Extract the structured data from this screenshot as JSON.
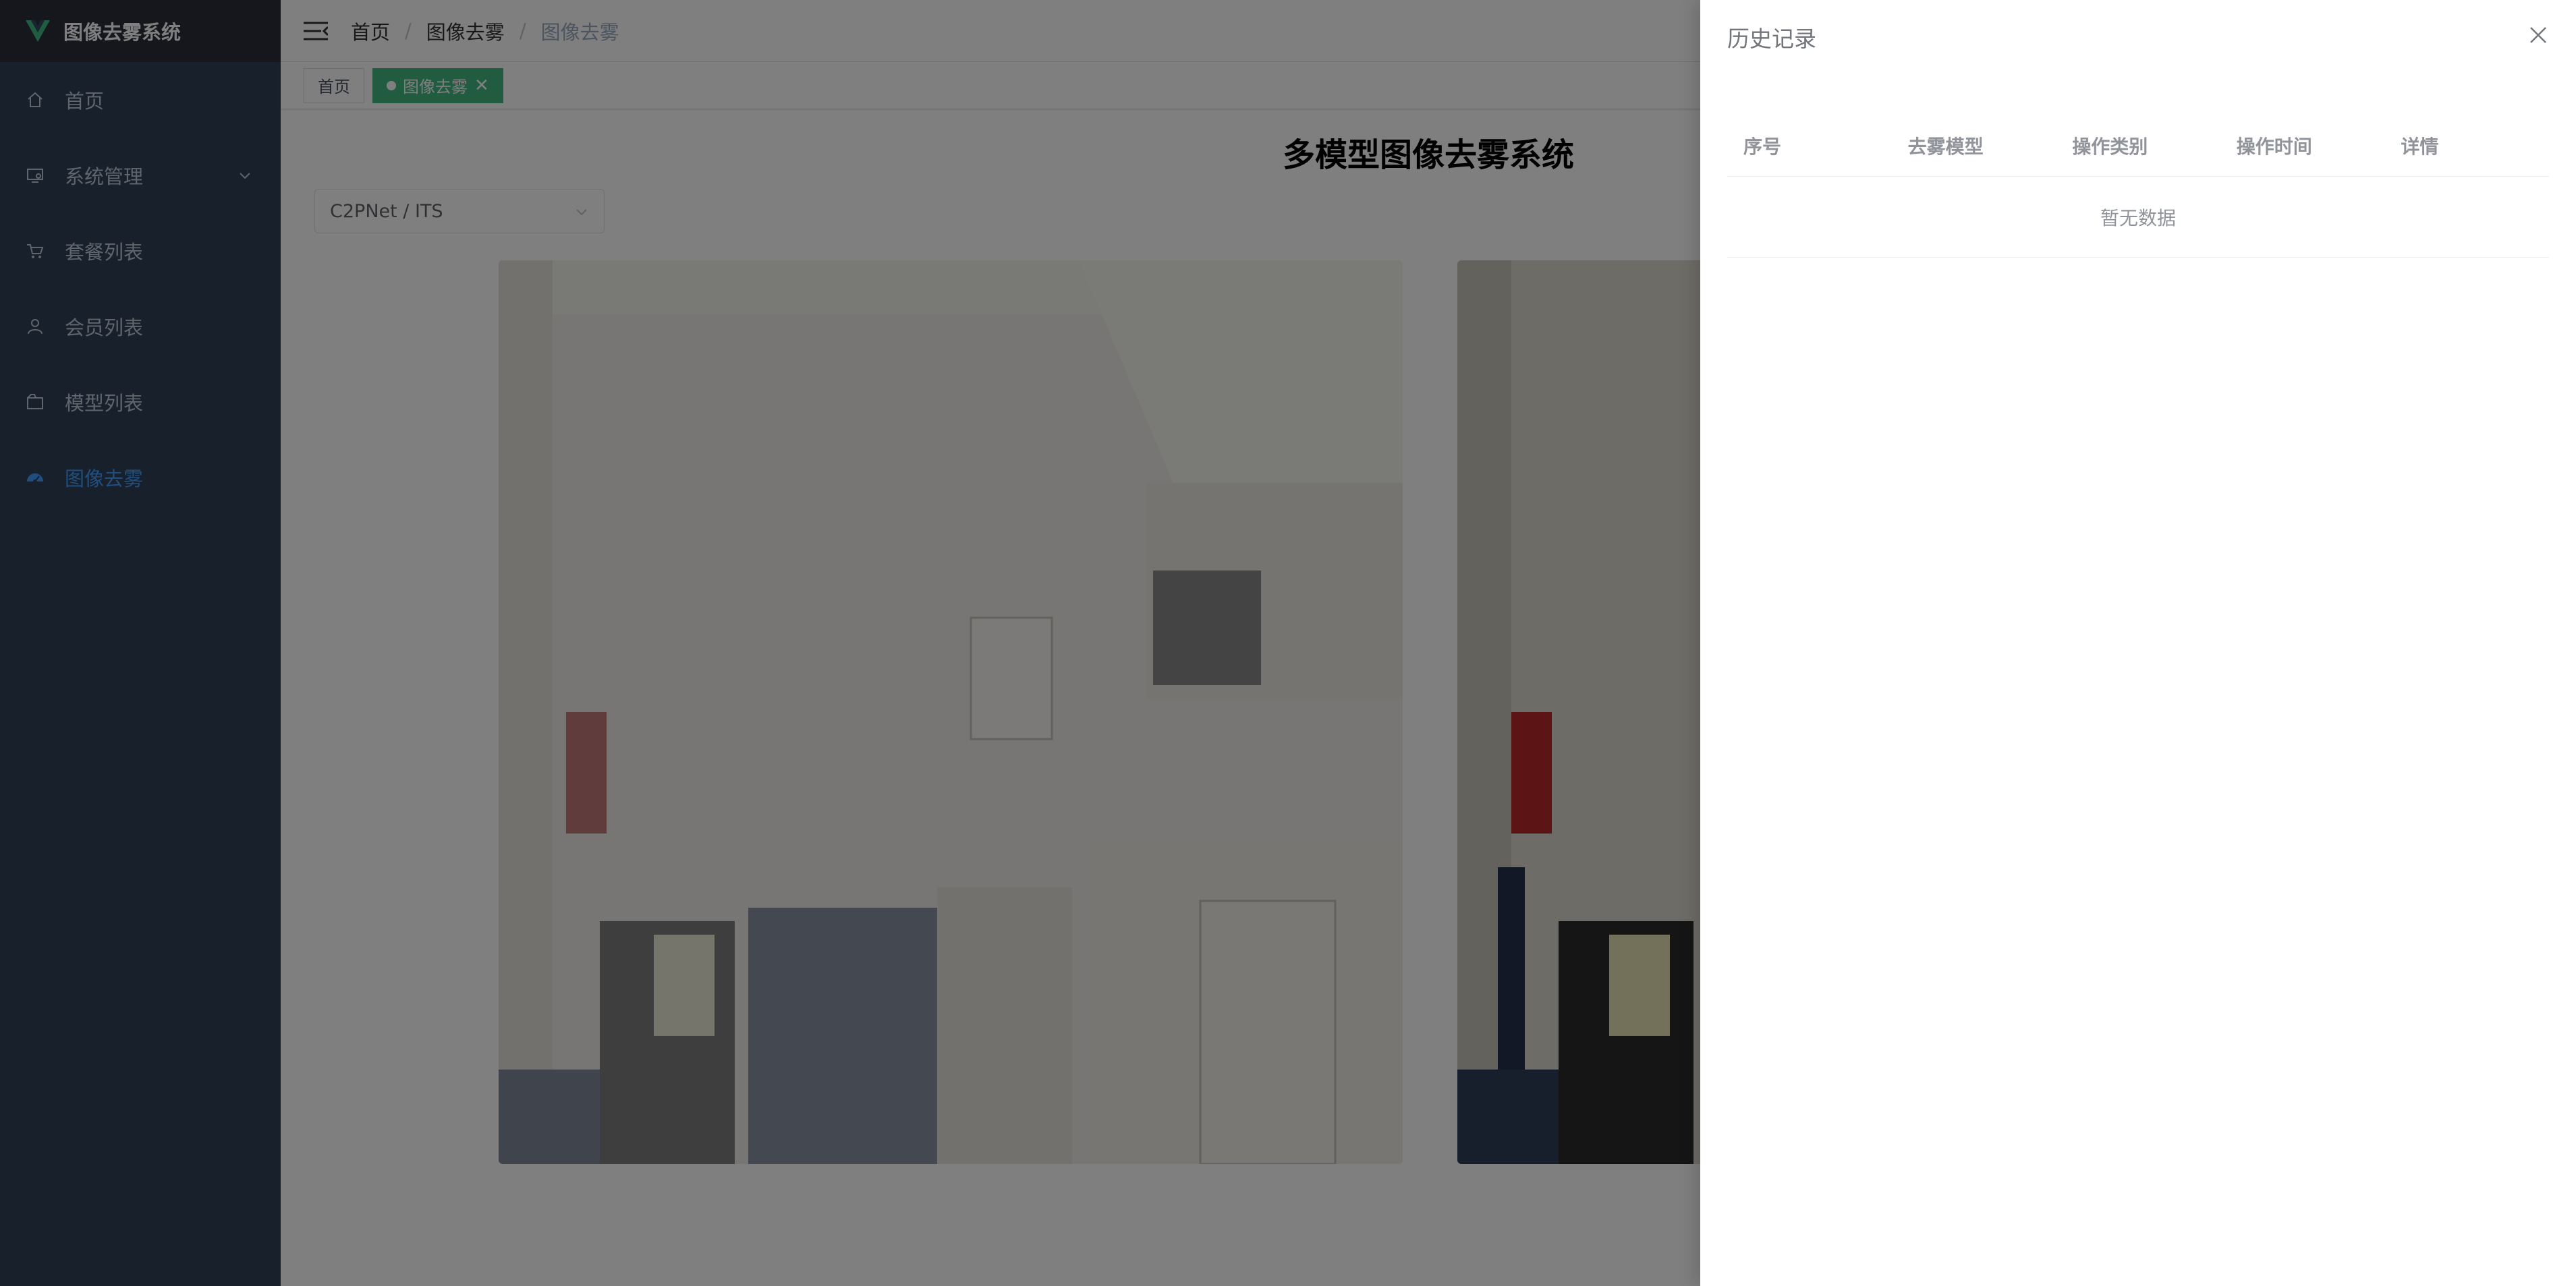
{
  "app": {
    "title": "图像去雾系统",
    "accent": "#409eff",
    "sidebar_bg": "#304156"
  },
  "sidebar": {
    "items": [
      {
        "label": "首页",
        "icon": "home-icon"
      },
      {
        "label": "系统管理",
        "icon": "settings-monitor-icon",
        "has_submenu": true
      },
      {
        "label": "套餐列表",
        "icon": "cart-icon"
      },
      {
        "label": "会员列表",
        "icon": "user-icon"
      },
      {
        "label": "模型列表",
        "icon": "box-icon"
      },
      {
        "label": "图像去雾",
        "icon": "dashboard-icon",
        "active": true
      }
    ]
  },
  "navbar": {
    "breadcrumb": [
      "首页",
      "图像去雾",
      "图像去雾"
    ],
    "separator": "/"
  },
  "tags": [
    {
      "label": "首页",
      "active": false
    },
    {
      "label": "图像去雾",
      "active": true,
      "close": "✕"
    }
  ],
  "main": {
    "title": "多模型图像去雾系统",
    "model_select": {
      "value": "C2PNet / ITS"
    }
  },
  "drawer": {
    "title": "历史记录",
    "columns": [
      "序号",
      "去雾模型",
      "操作类别",
      "操作时间",
      "详情"
    ],
    "empty_text": "暂无数据"
  }
}
